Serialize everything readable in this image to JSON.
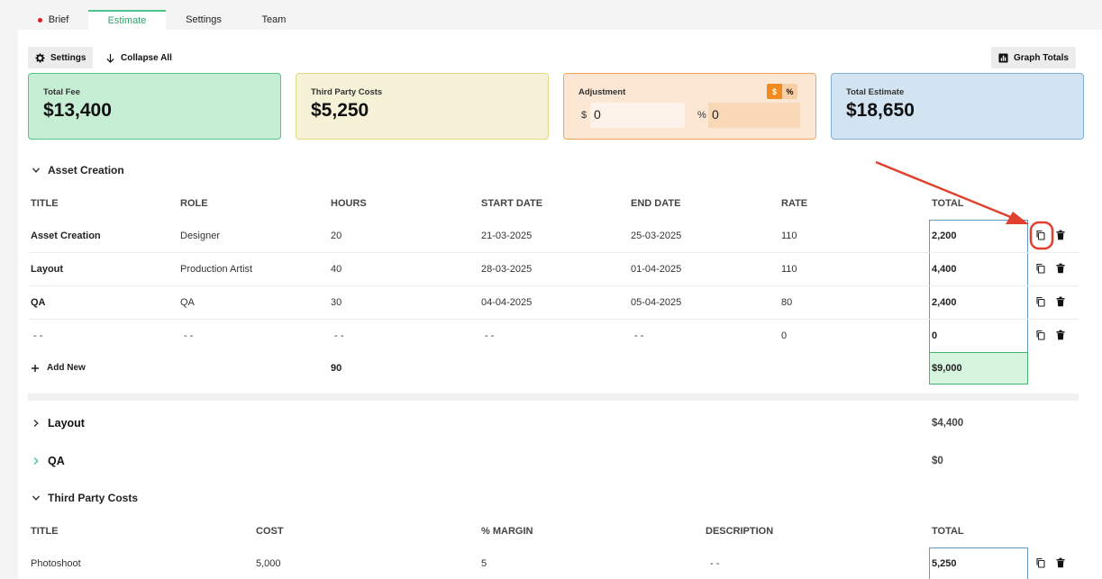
{
  "tabs": [
    "Brief",
    "Estimate",
    "Settings",
    "Team"
  ],
  "toolbar": {
    "settings": "Settings",
    "collapse": "Collapse All",
    "graph": "Graph Totals"
  },
  "cards": {
    "fee_label": "Total Fee",
    "fee_value": "$13,400",
    "tpc_label": "Third Party Costs",
    "tpc_value": "$5,250",
    "adj_label": "Adjustment",
    "adj_dollar": "$",
    "adj_percent": "%",
    "adj_dollar_prefix": "$",
    "adj_dollar_value": "0",
    "adj_percent_prefix": "%",
    "adj_percent_value": "0",
    "est_label": "Total Estimate",
    "est_value": "$18,650"
  },
  "asset": {
    "title": "Asset Creation",
    "headers": [
      "TITLE",
      "ROLE",
      "HOURS",
      "START DATE",
      "END DATE",
      "RATE",
      "TOTAL"
    ],
    "rows": [
      {
        "title": "Asset Creation",
        "role": "Designer",
        "hours": "20",
        "start": "21-03-2025",
        "end": "25-03-2025",
        "rate": "110",
        "total": "2,200"
      },
      {
        "title": "Layout",
        "role": "Production Artist",
        "hours": "40",
        "start": "28-03-2025",
        "end": "01-04-2025",
        "rate": "110",
        "total": "4,400"
      },
      {
        "title": "QA",
        "role": "QA",
        "hours": "30",
        "start": "04-04-2025",
        "end": "05-04-2025",
        "rate": "80",
        "total": "2,400"
      },
      {
        "title": "- -",
        "role": "- -",
        "hours": "- -",
        "start": "- -",
        "end": "- -",
        "rate": "0",
        "total": "0"
      }
    ],
    "add_new": "Add New",
    "hours_total": "90",
    "sum_total": "$9,000"
  },
  "layout_section": {
    "title": "Layout",
    "total": "$4,400"
  },
  "qa_section": {
    "title": "QA",
    "total": "$0"
  },
  "third_party": {
    "title": "Third Party Costs",
    "headers": [
      "TITLE",
      "COST",
      "% MARGIN",
      "DESCRIPTION",
      "TOTAL"
    ],
    "rows": [
      {
        "title": "Photoshoot",
        "cost": "5,000",
        "margin": "5",
        "description": "- -",
        "total": "5,250"
      }
    ]
  },
  "colors": {
    "accent": "#4cc38a",
    "annotation": "#e0412f"
  },
  "icons": [
    "gear-icon",
    "arrow-down-icon",
    "chart-icon",
    "chevron-down-icon",
    "chevron-right-icon",
    "plus-icon",
    "copy-icon",
    "trash-icon"
  ]
}
